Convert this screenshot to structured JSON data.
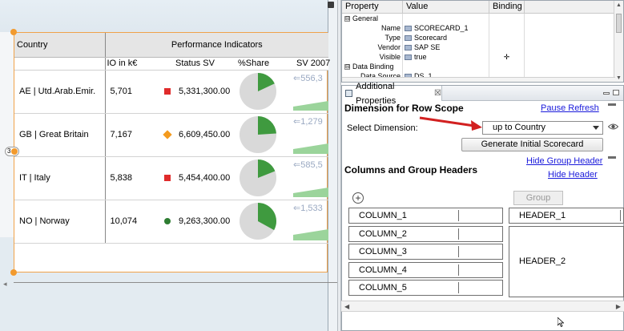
{
  "scorecard": {
    "header_country": "Country",
    "header_group": "Performance Indicators",
    "col_io": "IO in k€",
    "col_status": "Status SV",
    "col_share": "%Share",
    "col_sv": "SV 2007",
    "row_handle": "3",
    "rows": [
      {
        "country": "AE | Utd.Arab.Emir.",
        "io": "5,701",
        "status_value": "5,331,300.00",
        "status_mark": "red-square",
        "share_fraction": 0.18,
        "sv_value": "556,3"
      },
      {
        "country": "GB | Great Britain",
        "io": "7,167",
        "status_value": "6,609,450.00",
        "status_mark": "orange-diamond",
        "share_fraction": 0.24,
        "sv_value": "1,279"
      },
      {
        "country": "IT | Italy",
        "io": "5,838",
        "status_value": "5,454,400.00",
        "status_mark": "red-square",
        "share_fraction": 0.19,
        "sv_value": "585,5"
      },
      {
        "country": "NO | Norway",
        "io": "10,074",
        "status_value": "9,263,300.00",
        "status_mark": "green-circle",
        "share_fraction": 0.33,
        "sv_value": "1,533"
      }
    ]
  },
  "properties": {
    "columns": [
      "Property",
      "Value",
      "Binding"
    ],
    "rows": [
      {
        "type": "group",
        "expander": "⊟",
        "name": "General",
        "value": ""
      },
      {
        "type": "prop",
        "name": "Name",
        "value": "SCORECARD_1",
        "icon": true
      },
      {
        "type": "prop",
        "name": "Type",
        "value": "Scorecard",
        "icon": true
      },
      {
        "type": "prop",
        "name": "Vendor",
        "value": "SAP SE",
        "icon": true
      },
      {
        "type": "prop",
        "name": "Visible",
        "value": "true",
        "icon": true,
        "binding": "✛"
      },
      {
        "type": "group",
        "expander": "⊟",
        "name": "Data Binding",
        "value": ""
      },
      {
        "type": "prop",
        "name": "Data Source",
        "value": "DS_1",
        "icon": true
      }
    ]
  },
  "additional": {
    "tab_label": "Additional Properties",
    "tab_close": "☒",
    "row_scope_title": "Dimension for Row Scope",
    "pause_refresh": "Pause Refresh",
    "select_dimension_label": "Select Dimension:",
    "select_dimension_value": "up to Country",
    "generate_button": "Generate Initial Scorecard",
    "hide_group_header": "Hide Group Header",
    "hide_header": "Hide Header",
    "columns_title": "Columns and Group Headers",
    "add_column": "+",
    "group_button": "Group",
    "columns": [
      "COLUMN_1",
      "COLUMN_2",
      "COLUMN_3",
      "COLUMN_4",
      "COLUMN_5"
    ],
    "headers": [
      "HEADER_1",
      "HEADER_2"
    ]
  },
  "colors": {
    "pie_fill": "#3f9a3f",
    "pie_bg": "#d9d9d9",
    "sv_bar": "#9bd49b",
    "selection": "#f29a2e",
    "link": "#1a1adb",
    "arrow_red": "#d22020"
  },
  "icons": [
    "eye-icon",
    "close-icon",
    "add-icon",
    "expand-icon",
    "property-value-icon",
    "cursor-icon"
  ]
}
